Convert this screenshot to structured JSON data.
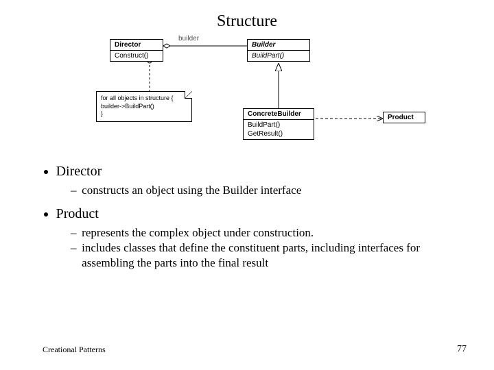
{
  "title": "Structure",
  "uml": {
    "director": {
      "name": "Director",
      "op1": "Construct()"
    },
    "builder": {
      "name": "Builder",
      "op1": "BuildPart()"
    },
    "concrete": {
      "name": "ConcreteBuilder",
      "op1": "BuildPart()",
      "op2": "GetResult()"
    },
    "product": {
      "name": "Product"
    },
    "assoc_label": "builder",
    "note_line1": "for all objects in structure {",
    "note_line2": "  builder->BuildPart()",
    "note_line3": "}"
  },
  "bullets": {
    "director": "Director",
    "director_sub1": "constructs an object using the Builder interface",
    "product": "Product",
    "product_sub1": "represents the complex object under construction.",
    "product_sub2": "includes classes that define the constituent parts, including interfaces for assembling the parts into the final result"
  },
  "footer": {
    "left": "Creational Patterns",
    "page": "77"
  }
}
